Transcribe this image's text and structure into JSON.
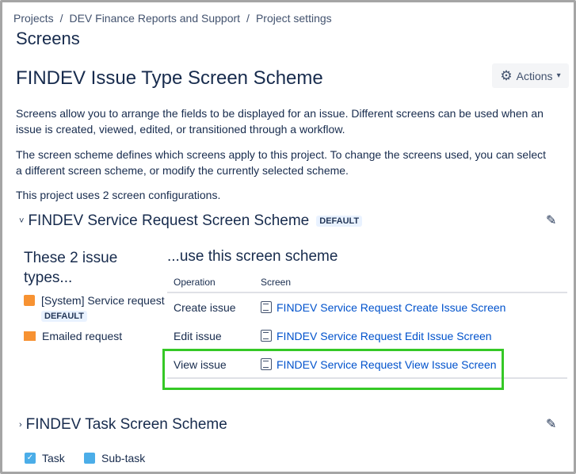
{
  "breadcrumb": [
    "Projects",
    "DEV Finance Reports and Support",
    "Project settings"
  ],
  "page_title": "Screens",
  "scheme_title": "FINDEV Issue Type Screen Scheme",
  "actions_label": "Actions",
  "desc1": "Screens allow you to arrange the fields to be displayed for an issue. Different screens can be used when an issue is created, viewed, edited, or transitioned through a workflow.",
  "desc2": "The screen scheme defines which screens apply to this project. To change the screens used, you can select a different screen scheme, or modify the currently selected scheme.",
  "desc3": "This project uses 2 screen configurations.",
  "schemes": [
    {
      "name": "FINDEV Service Request Screen Scheme",
      "badge": "DEFAULT",
      "issue_types_heading": "These 2 issue types...",
      "use_heading": "...use this screen scheme",
      "issue_types": [
        {
          "name": "[System] Service request",
          "badge": "DEFAULT"
        },
        {
          "name": "Emailed request"
        }
      ],
      "columns": [
        "Operation",
        "Screen"
      ],
      "rows": [
        {
          "operation": "Create issue",
          "screen": "FINDEV Service Request Create Issue Screen"
        },
        {
          "operation": "Edit issue",
          "screen": "FINDEV Service Request Edit Issue Screen"
        },
        {
          "operation": "View issue",
          "screen": "FINDEV Service Request View Issue Screen"
        }
      ]
    },
    {
      "name": "FINDEV Task Screen Scheme",
      "issue_types": [
        {
          "name": "Task"
        },
        {
          "name": "Sub-task"
        }
      ]
    }
  ],
  "colors": {
    "link": "#0052cc",
    "highlight": "#35c826"
  }
}
